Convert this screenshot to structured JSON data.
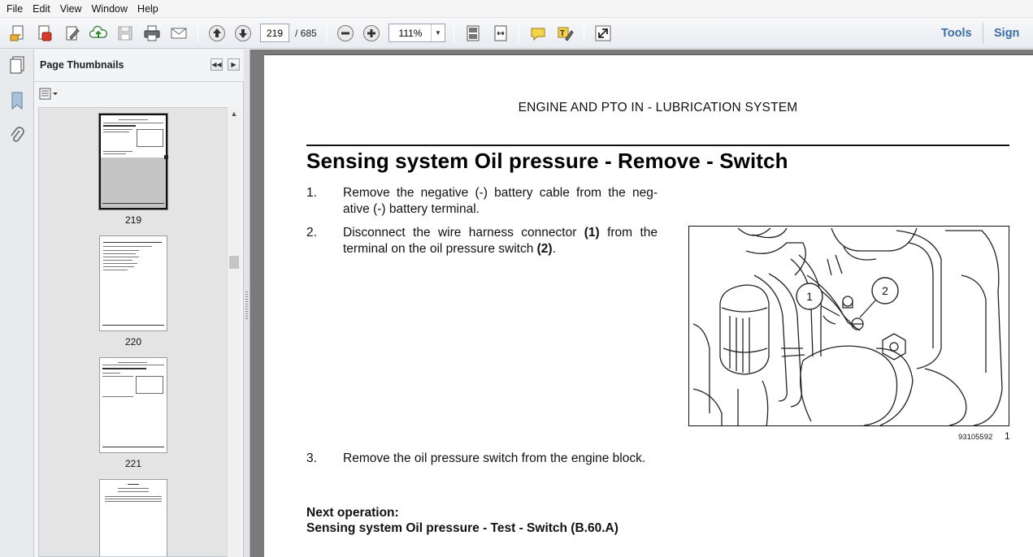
{
  "menu": [
    "File",
    "Edit",
    "View",
    "Window",
    "Help"
  ],
  "toolbar": {
    "current_page": "219",
    "total_pages": "/ 685",
    "zoom": "111%",
    "tools_label": "Tools",
    "sign_label": "Sign"
  },
  "panel": {
    "title": "Page Thumbnails",
    "thumbnails": [
      "219",
      "220",
      "221"
    ]
  },
  "document": {
    "running_header": "ENGINE AND PTO IN - LUBRICATION SYSTEM",
    "title": "Sensing system Oil pressure - Remove - Switch",
    "steps": [
      {
        "num": "1.",
        "text": "Remove the negative (-) battery cable from the neg-ative (-) battery terminal."
      },
      {
        "num": "2.",
        "text_before": "Disconnect the wire harness connector ",
        "ref1": "(1)",
        "text_mid": " from the terminal on the oil pressure switch ",
        "ref2": "(2)",
        "text_after": "."
      },
      {
        "num": "3.",
        "text": "Remove the oil pressure switch from the engine block."
      }
    ],
    "figure": {
      "callouts": [
        "1",
        "2"
      ],
      "reference": "93105592",
      "number": "1"
    },
    "next_operation_label": "Next operation:",
    "next_operation_link": "Sensing system Oil pressure - Test - Switch (B.60.A)"
  }
}
